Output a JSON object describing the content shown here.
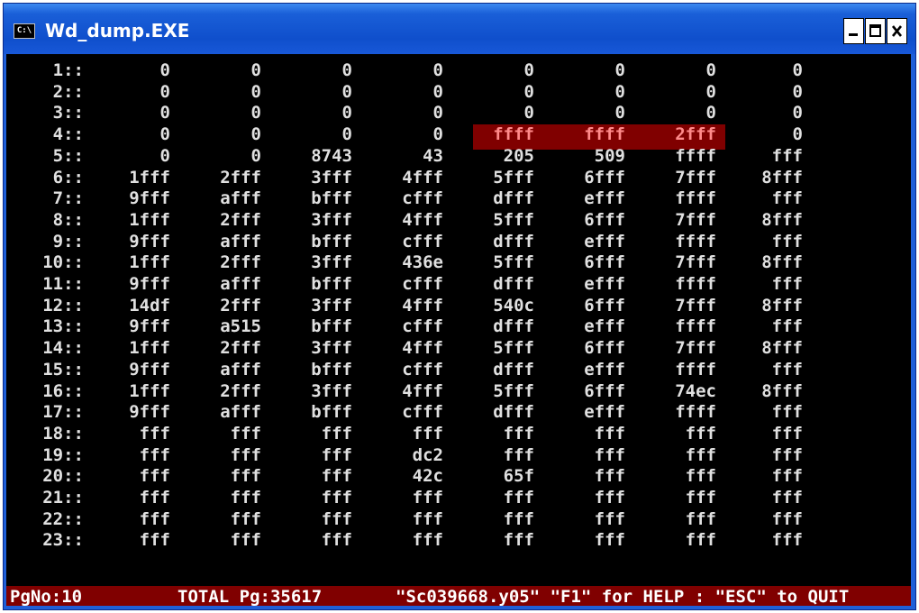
{
  "window": {
    "title": "Wd_dump.EXE",
    "icon_text": "C:\\"
  },
  "rows": [
    {
      "idx": "1::",
      "cols": [
        "0",
        "0",
        "0",
        "0",
        "0",
        "0",
        "0",
        "0"
      ]
    },
    {
      "idx": "2::",
      "cols": [
        "0",
        "0",
        "0",
        "0",
        "0",
        "0",
        "0",
        "0"
      ]
    },
    {
      "idx": "3::",
      "cols": [
        "0",
        "0",
        "0",
        "0",
        "0",
        "0",
        "0",
        "0"
      ]
    },
    {
      "idx": "4::",
      "cols": [
        "0",
        "0",
        "0",
        "0",
        "ffff",
        "ffff",
        "2fff",
        "0"
      ]
    },
    {
      "idx": "5::",
      "cols": [
        "0",
        "0",
        "8743",
        "43",
        "205",
        "509",
        "ffff",
        "fff"
      ]
    },
    {
      "idx": "6::",
      "cols": [
        "1fff",
        "2fff",
        "3fff",
        "4fff",
        "5fff",
        "6fff",
        "7fff",
        "8fff"
      ]
    },
    {
      "idx": "7::",
      "cols": [
        "9fff",
        "afff",
        "bfff",
        "cfff",
        "dfff",
        "efff",
        "ffff",
        "fff"
      ]
    },
    {
      "idx": "8::",
      "cols": [
        "1fff",
        "2fff",
        "3fff",
        "4fff",
        "5fff",
        "6fff",
        "7fff",
        "8fff"
      ]
    },
    {
      "idx": "9::",
      "cols": [
        "9fff",
        "afff",
        "bfff",
        "cfff",
        "dfff",
        "efff",
        "ffff",
        "fff"
      ]
    },
    {
      "idx": "10::",
      "cols": [
        "1fff",
        "2fff",
        "3fff",
        "436e",
        "5fff",
        "6fff",
        "7fff",
        "8fff"
      ]
    },
    {
      "idx": "11::",
      "cols": [
        "9fff",
        "afff",
        "bfff",
        "cfff",
        "dfff",
        "efff",
        "ffff",
        "fff"
      ]
    },
    {
      "idx": "12::",
      "cols": [
        "14df",
        "2fff",
        "3fff",
        "4fff",
        "540c",
        "6fff",
        "7fff",
        "8fff"
      ]
    },
    {
      "idx": "13::",
      "cols": [
        "9fff",
        "a515",
        "bfff",
        "cfff",
        "dfff",
        "efff",
        "ffff",
        "fff"
      ]
    },
    {
      "idx": "14::",
      "cols": [
        "1fff",
        "2fff",
        "3fff",
        "4fff",
        "5fff",
        "6fff",
        "7fff",
        "8fff"
      ]
    },
    {
      "idx": "15::",
      "cols": [
        "9fff",
        "afff",
        "bfff",
        "cfff",
        "dfff",
        "efff",
        "ffff",
        "fff"
      ]
    },
    {
      "idx": "16::",
      "cols": [
        "1fff",
        "2fff",
        "3fff",
        "4fff",
        "5fff",
        "6fff",
        "74ec",
        "8fff"
      ]
    },
    {
      "idx": "17::",
      "cols": [
        "9fff",
        "afff",
        "bfff",
        "cfff",
        "dfff",
        "efff",
        "ffff",
        "fff"
      ]
    },
    {
      "idx": "18::",
      "cols": [
        "fff",
        "fff",
        "fff",
        "fff",
        "fff",
        "fff",
        "fff",
        "fff"
      ]
    },
    {
      "idx": "19::",
      "cols": [
        "fff",
        "fff",
        "fff",
        "dc2",
        "fff",
        "fff",
        "fff",
        "fff"
      ]
    },
    {
      "idx": "20::",
      "cols": [
        "fff",
        "fff",
        "fff",
        "42c",
        "65f",
        "fff",
        "fff",
        "fff"
      ]
    },
    {
      "idx": "21::",
      "cols": [
        "fff",
        "fff",
        "fff",
        "fff",
        "fff",
        "fff",
        "fff",
        "fff"
      ]
    },
    {
      "idx": "22::",
      "cols": [
        "fff",
        "fff",
        "fff",
        "fff",
        "fff",
        "fff",
        "fff",
        "fff"
      ]
    },
    {
      "idx": "23::",
      "cols": [
        "fff",
        "fff",
        "fff",
        "fff",
        "fff",
        "fff",
        "fff",
        "fff"
      ]
    }
  ],
  "highlight": {
    "row": 4,
    "columns": [
      5,
      6,
      7
    ],
    "color": "#800000",
    "text_color": "#ff8a8a"
  },
  "status": {
    "page": "PgNo:10",
    "total": "TOTAL Pg:35617",
    "help": "\"Sc039668.y05\" \"F1\" for HELP : \"ESC\" to QUIT"
  },
  "colors": {
    "titlebar": "#1f5fd8",
    "console_bg": "#000000",
    "text": "#e0e0e0",
    "status_bg": "#800000"
  },
  "icons": [
    "console-app-icon",
    "minimize-icon",
    "maximize-icon",
    "close-icon"
  ]
}
